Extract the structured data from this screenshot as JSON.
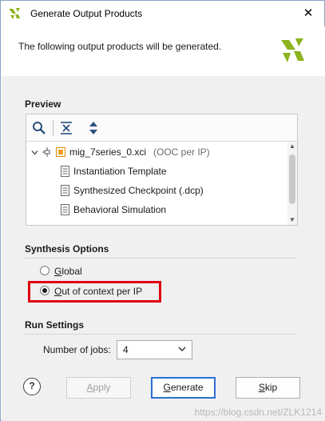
{
  "window": {
    "title": "Generate Output Products",
    "close_glyph": "✕",
    "icon": "vivado-logo-icon"
  },
  "banner": {
    "message": "The following output products will be generated."
  },
  "preview": {
    "title": "Preview",
    "toolbar": [
      "search-icon",
      "collapse-all-icon",
      "expand-all-icon"
    ],
    "tree": {
      "root": {
        "name": "mig_7series_0.xci",
        "annotation": "(OOC per IP)"
      },
      "children": [
        "Instantiation Template",
        "Synthesized Checkpoint (.dcp)",
        "Behavioral Simulation"
      ]
    }
  },
  "synthesis": {
    "title": "Synthesis Options",
    "options": [
      {
        "label": "Global",
        "selected": false
      },
      {
        "label": "Out of context per IP",
        "selected": true
      }
    ],
    "highlight_color": "#e0000f"
  },
  "run_settings": {
    "title": "Run Settings",
    "jobs_label": "Number of jobs:",
    "jobs_value": "4"
  },
  "buttons": {
    "help": "?",
    "apply": "Apply",
    "generate": "Generate",
    "skip": "Skip"
  },
  "watermark": "https://blog.csdn.net/ZLK1214",
  "colors": {
    "accent": "#2c6fd0",
    "vivado_logo": "#8bb31d",
    "ooc_text": "#6b6b6b"
  }
}
